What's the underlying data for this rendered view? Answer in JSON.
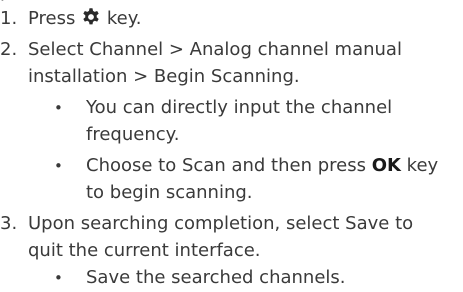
{
  "top_fragment": "p",
  "steps": [
    {
      "number": "1.",
      "parts": {
        "before": "Press",
        "icon": "gear-icon",
        "after": "key."
      }
    },
    {
      "number": "2.",
      "lines": [
        "Select Channel > Analog channel manual",
        "installation > Begin Scanning."
      ],
      "bullets": [
        {
          "lines": [
            "You can directly input the channel",
            "frequency."
          ]
        },
        {
          "line1_before": "Choose to Scan and then press ",
          "line1_bold": "OK",
          "line1_after": " key",
          "line2": "to begin scanning."
        }
      ]
    },
    {
      "number": "3.",
      "lines": [
        "Upon searching completion, select Save to",
        "quit the current interface."
      ],
      "bullets": [
        {
          "lines": [
            "Save the searched channels."
          ]
        }
      ]
    }
  ],
  "bullet_char": "•"
}
